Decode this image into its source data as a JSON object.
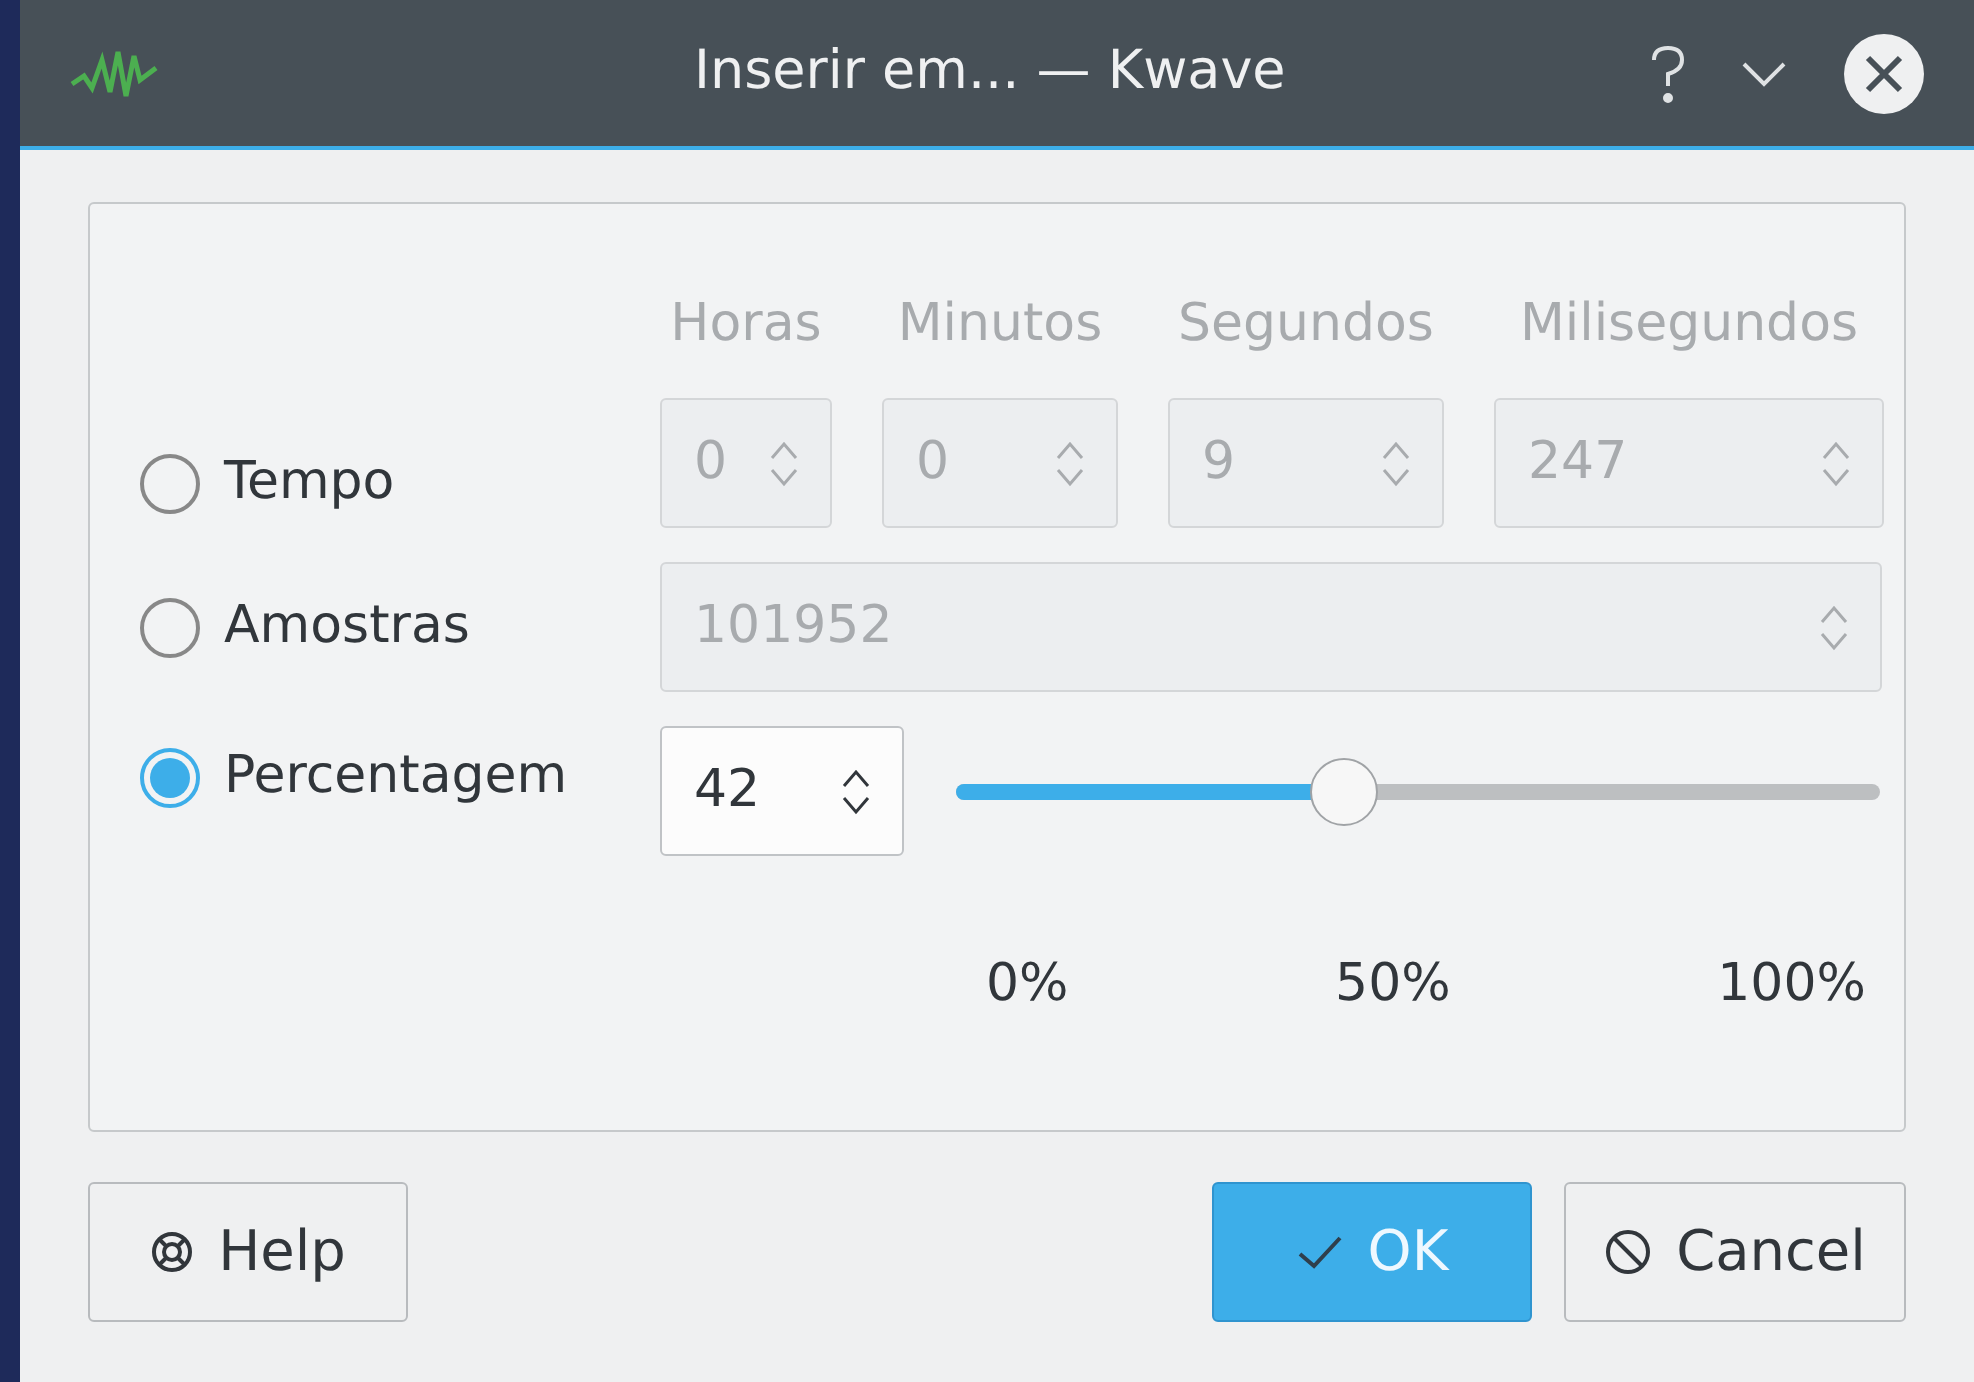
{
  "title_bar": {
    "title": "Inserir em... — Kwave"
  },
  "time_columns": [
    {
      "heading": "Horas",
      "value": "0"
    },
    {
      "heading": "Minutos",
      "value": "0"
    },
    {
      "heading": "Segundos",
      "value": "9"
    },
    {
      "heading": "Milisegundos",
      "value": "247"
    }
  ],
  "modes": [
    {
      "label": "Tempo",
      "selected": false
    },
    {
      "label": "Amostras",
      "selected": false
    },
    {
      "label": "Percentagem",
      "selected": true
    }
  ],
  "samples": {
    "value": "101952"
  },
  "percentage": {
    "value": "42",
    "level": 0.42
  },
  "scale_labels": [
    "0%",
    "50%",
    "100%"
  ],
  "buttons": [
    {
      "kind": "help",
      "label": "Help"
    },
    {
      "kind": "ok",
      "label": "OK"
    },
    {
      "kind": "cancel",
      "label": "Cancel"
    }
  ]
}
